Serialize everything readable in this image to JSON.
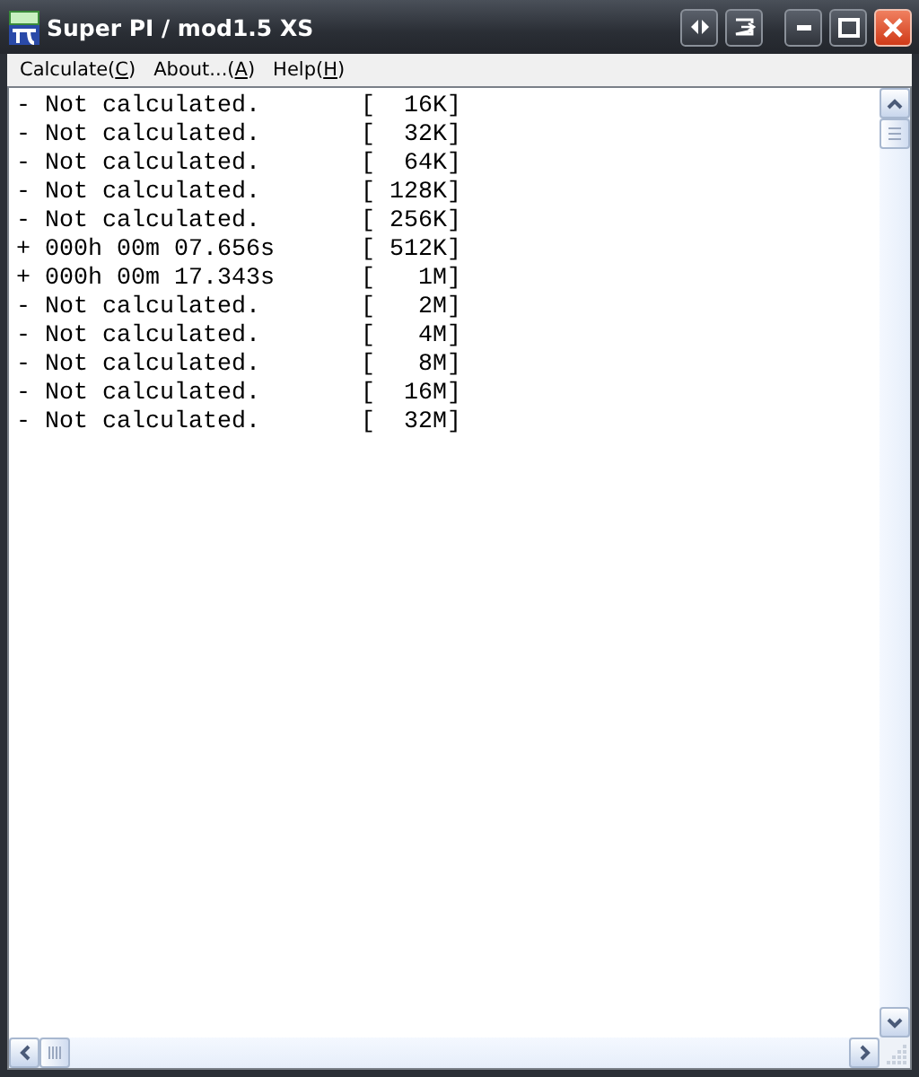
{
  "window": {
    "title": "Super PI / mod1.5 XS"
  },
  "menu": [
    {
      "before": "Calculate(",
      "key": "C",
      "after": ")"
    },
    {
      "before": "About...(",
      "key": "A",
      "after": ")"
    },
    {
      "before": "Help(",
      "key": "H",
      "after": ")"
    }
  ],
  "lines": [
    "- Not calculated.       [  16K]",
    "- Not calculated.       [  32K]",
    "- Not calculated.       [  64K]",
    "- Not calculated.       [ 128K]",
    "- Not calculated.       [ 256K]",
    "+ 000h 00m 07.656s      [ 512K]",
    "+ 000h 00m 17.343s      [   1M]",
    "- Not calculated.       [   2M]",
    "- Not calculated.       [   4M]",
    "- Not calculated.       [   8M]",
    "- Not calculated.       [  16M]",
    "- Not calculated.       [  32M]"
  ]
}
